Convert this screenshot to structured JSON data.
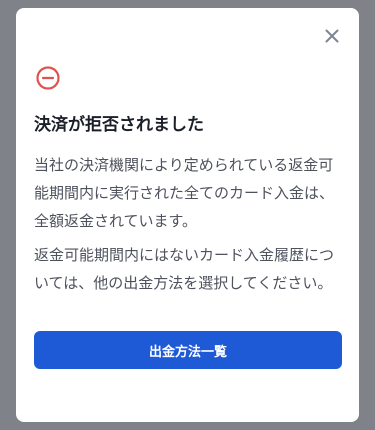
{
  "dialog": {
    "title": "決済が拒否されました",
    "paragraph_1": "当社の決済機関により定められている返金可能期間内に実行された全てのカード入金は、全額返金されています。",
    "paragraph_2": "返金可能期間内にはないカード入金履歴については、他の出金方法を選択してください。",
    "primary_button_label": "出金方法一覧",
    "icons": {
      "close": "close-icon",
      "status": "minus-circle-icon"
    },
    "colors": {
      "status_icon": "#e0524d",
      "primary_button": "#1f5ad6",
      "overlay": "#7f8289"
    }
  }
}
